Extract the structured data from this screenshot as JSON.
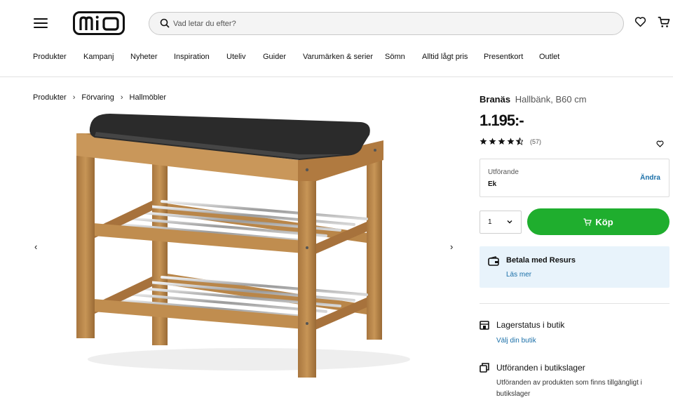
{
  "header": {
    "logo_text": "mio",
    "search_placeholder": "Vad letar du efter?",
    "icons": [
      "menu-icon",
      "search-icon",
      "heart-icon",
      "cart-icon"
    ]
  },
  "nav": {
    "items": [
      "Produkter",
      "Kampanj",
      "Nyheter",
      "Inspiration",
      "Uteliv",
      "Guider",
      "Varumärken & serier",
      "Sömn",
      "Alltid lågt pris",
      "Presentkort",
      "Outlet"
    ]
  },
  "breadcrumb": [
    "Produkter",
    "Förvaring",
    "Hallmöbler"
  ],
  "product": {
    "brand": "Branäs",
    "description": "Hallbänk, B60 cm",
    "price": "1.195:-",
    "rating": 4.5,
    "review_count": "(57)"
  },
  "variant": {
    "label": "Utförande",
    "value": "Ek",
    "change_label": "Ändra"
  },
  "purchase": {
    "quantity": "1",
    "buy_label": "Köp"
  },
  "resurs": {
    "title": "Betala med Resurs",
    "link": "Läs mer"
  },
  "store_stock": {
    "title": "Lagerstatus i butik",
    "link": "Välj din butik"
  },
  "variants_in_store": {
    "title": "Utföranden i butikslager",
    "description": "Utföranden av produkten som finns tillgängligt i butikslager"
  },
  "colors": {
    "buy_button": "#1fae2e",
    "link": "#1a6fa8",
    "resurs_bg": "#e8f3fb"
  }
}
